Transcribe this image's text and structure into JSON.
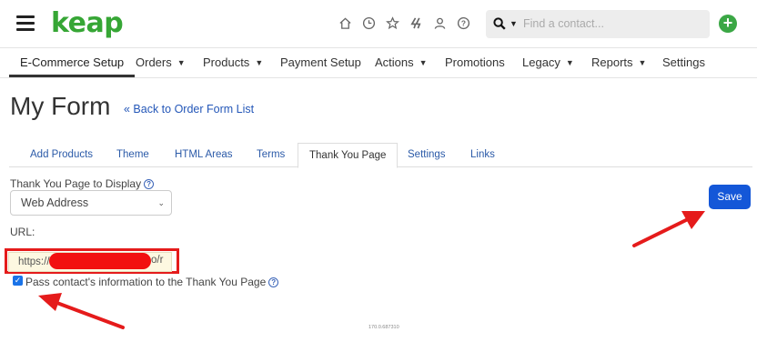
{
  "header": {
    "logo_text": "keap",
    "search_placeholder": "Find a contact...",
    "add_label": "+",
    "icons": [
      "home-icon",
      "clock-icon",
      "star-icon",
      "bolt-icon",
      "person-icon",
      "help-circle-icon"
    ]
  },
  "menu": {
    "items": [
      {
        "label": "E-Commerce Setup",
        "dropdown": false,
        "active": true
      },
      {
        "label": "Orders",
        "dropdown": true
      },
      {
        "label": "Products",
        "dropdown": true
      },
      {
        "label": "Payment Setup",
        "dropdown": false
      },
      {
        "label": "Actions",
        "dropdown": true
      },
      {
        "label": "Promotions",
        "dropdown": false
      },
      {
        "label": "Legacy",
        "dropdown": true
      },
      {
        "label": "Reports",
        "dropdown": true
      },
      {
        "label": "Settings",
        "dropdown": false
      }
    ]
  },
  "page": {
    "title": "My Form",
    "back_link": "« Back to Order Form List"
  },
  "tabs": [
    {
      "label": "Add Products"
    },
    {
      "label": "Theme"
    },
    {
      "label": "HTML Areas"
    },
    {
      "label": "Terms"
    },
    {
      "label": "Thank You Page",
      "active": true
    },
    {
      "label": "Settings"
    },
    {
      "label": "Links"
    }
  ],
  "form": {
    "display_label": "Thank You Page to Display",
    "display_value": "Web Address",
    "url_label": "URL:",
    "url_prefix": "https://",
    "url_suffix": "o/r",
    "pass_info_label": "Pass contact's information to the Thank You Page",
    "pass_info_checked": true
  },
  "actions": {
    "save_label": "Save"
  },
  "footer": {
    "id_text": "170.0.687310"
  },
  "colors": {
    "brand": "#36a635",
    "link": "#2457b8",
    "save_button": "#1457d8",
    "annotation_red": "#e51b1b"
  }
}
